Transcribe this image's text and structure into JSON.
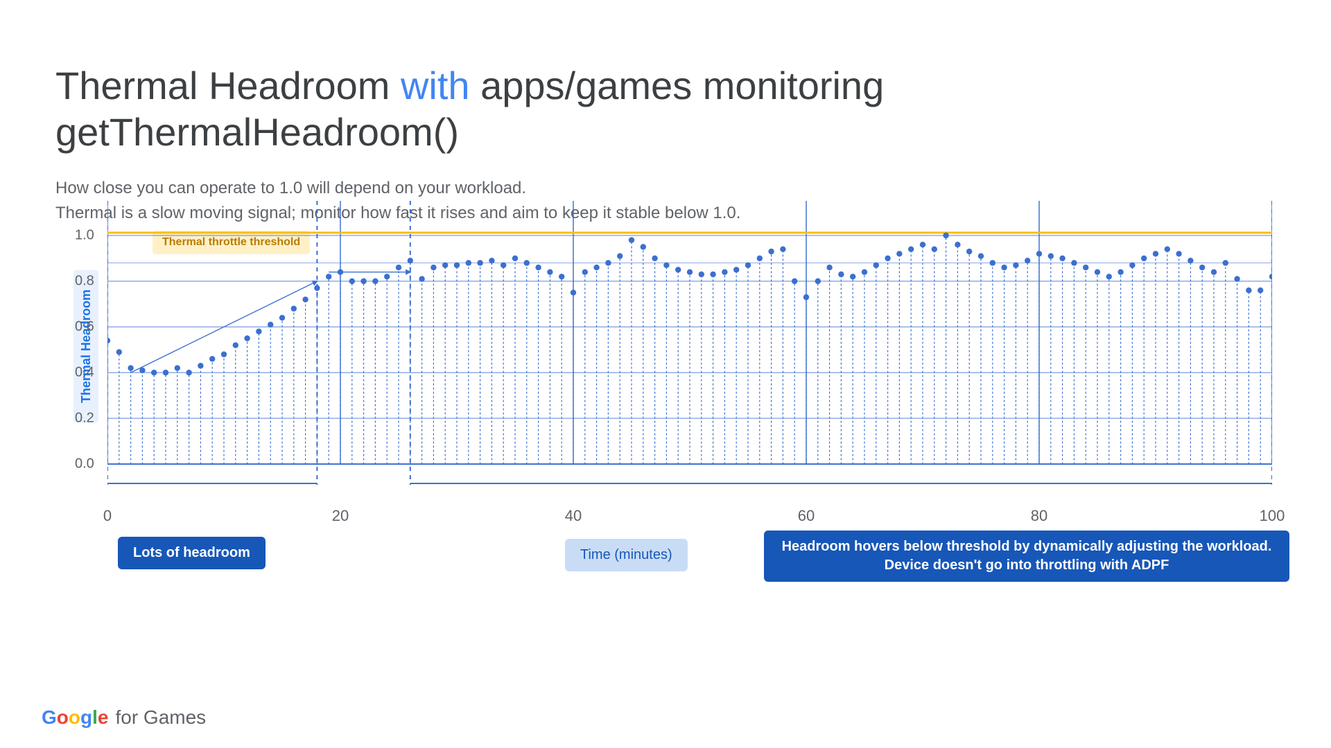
{
  "title": {
    "pre": "Thermal Headroom ",
    "accent": "with",
    "post": " apps/games monitoring getThermalHeadroom()"
  },
  "subtitle_line1": "How close you can operate to 1.0 will depend on your workload.",
  "subtitle_line2": "Thermal is a slow moving signal; monitor how fast it rises and aim to keep it stable below 1.0.",
  "ylabel": "Thermal Headroom",
  "xlabel": "Time (minutes)",
  "threshold_label": "Thermal throttle threshold",
  "badge_left": "Lots of headroom",
  "badge_right": "Headroom hovers below threshold by dynamically adjusting the workload. Device doesn't go into throttling with ADPF",
  "footer_suffix": "for Games",
  "chart_data": {
    "type": "scatter",
    "xlabel": "Time (minutes)",
    "ylabel": "Thermal Headroom",
    "xlim": [
      0,
      100
    ],
    "ylim": [
      0.0,
      1.0
    ],
    "xticks": [
      0,
      20,
      40,
      60,
      80,
      100
    ],
    "yticks": [
      0.0,
      0.2,
      0.4,
      0.6,
      0.8,
      1.0
    ],
    "threshold": 1.0,
    "guide_h": 0.88,
    "region_dividers": [
      0,
      18,
      26,
      100
    ],
    "arrow_up": {
      "x1": 2,
      "y1": 0.4,
      "x2": 18,
      "y2": 0.8
    },
    "arrow_right": {
      "x1": 19,
      "y1": 0.84,
      "x2": 26,
      "y2": 0.84
    },
    "x": [
      0,
      1,
      2,
      3,
      4,
      5,
      6,
      7,
      8,
      9,
      10,
      11,
      12,
      13,
      14,
      15,
      16,
      17,
      18,
      19,
      20,
      21,
      22,
      23,
      24,
      25,
      26,
      27,
      28,
      29,
      30,
      31,
      32,
      33,
      34,
      35,
      36,
      37,
      38,
      39,
      40,
      41,
      42,
      43,
      44,
      45,
      46,
      47,
      48,
      49,
      50,
      51,
      52,
      53,
      54,
      55,
      56,
      57,
      58,
      59,
      60,
      61,
      62,
      63,
      64,
      65,
      66,
      67,
      68,
      69,
      70,
      71,
      72,
      73,
      74,
      75,
      76,
      77,
      78,
      79,
      80,
      81,
      82,
      83,
      84,
      85,
      86,
      87,
      88,
      89,
      90,
      91,
      92,
      93,
      94,
      95,
      96,
      97,
      98,
      99,
      100
    ],
    "y": [
      0.54,
      0.49,
      0.42,
      0.41,
      0.4,
      0.4,
      0.42,
      0.4,
      0.43,
      0.46,
      0.48,
      0.52,
      0.55,
      0.58,
      0.61,
      0.64,
      0.68,
      0.72,
      0.77,
      0.82,
      0.84,
      0.8,
      0.8,
      0.8,
      0.82,
      0.86,
      0.89,
      0.81,
      0.86,
      0.87,
      0.87,
      0.88,
      0.88,
      0.89,
      0.87,
      0.9,
      0.88,
      0.86,
      0.84,
      0.82,
      0.75,
      0.84,
      0.86,
      0.88,
      0.91,
      0.98,
      0.95,
      0.9,
      0.87,
      0.85,
      0.84,
      0.83,
      0.83,
      0.84,
      0.85,
      0.87,
      0.9,
      0.93,
      0.94,
      0.8,
      0.73,
      0.8,
      0.86,
      0.83,
      0.82,
      0.84,
      0.87,
      0.9,
      0.92,
      0.94,
      0.96,
      0.94,
      1.0,
      0.96,
      0.93,
      0.91,
      0.88,
      0.86,
      0.87,
      0.89,
      0.92,
      0.91,
      0.9,
      0.88,
      0.86,
      0.84,
      0.82,
      0.84,
      0.87,
      0.9,
      0.92,
      0.94,
      0.92,
      0.89,
      0.86,
      0.84,
      0.88,
      0.81,
      0.76,
      0.76,
      0.82
    ]
  }
}
